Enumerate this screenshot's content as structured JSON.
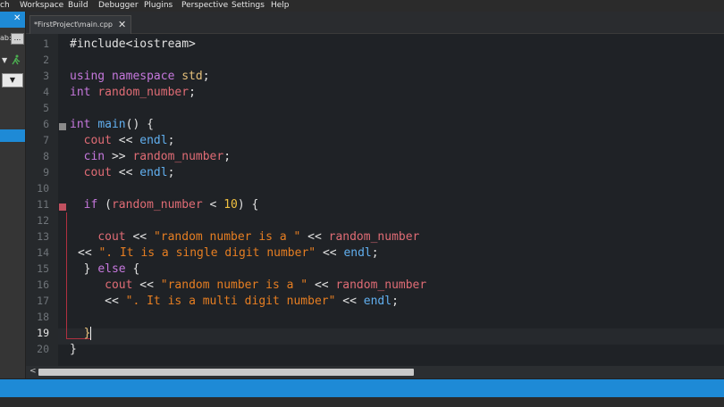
{
  "menu": [
    "ch",
    "Workspace",
    "Build",
    "Debugger",
    "Plugins",
    "Perspective",
    "Settings",
    "Help"
  ],
  "left_panel": {
    "label": "ab:",
    "more": "...",
    "dropdown": "▼"
  },
  "tab": {
    "title": "*FirstProject\\main.cpp",
    "close": "✕"
  },
  "line_numbers": [
    "1",
    "2",
    "3",
    "4",
    "5",
    "6",
    "7",
    "8",
    "9",
    "10",
    "11",
    "12",
    "13",
    "14",
    "15",
    "16",
    "17",
    "18",
    "19",
    "20"
  ],
  "active_line": "19",
  "code": {
    "l1": "#include<iostream>",
    "l3_kw": "using namespace",
    "l3_ns": "std",
    "l3_end": ";",
    "l4_type": "int",
    "l4_var": "random_number",
    "l4_end": ";",
    "l6_type": "int",
    "l6_fn": "main",
    "l6_rest": "() {",
    "l7_id": "cout",
    "l7_op": " << ",
    "l7_end": "endl",
    "l7_semi": ";",
    "l8_id": "cin",
    "l8_op": " >> ",
    "l8_var": "random_number",
    "l8_semi": ";",
    "l9_id": "cout",
    "l9_op": " << ",
    "l9_end": "endl",
    "l9_semi": ";",
    "l11_kw": "if",
    "l11_open": " (",
    "l11_var": "random_number",
    "l11_op": " < ",
    "l11_num": "10",
    "l11_close": ") {",
    "l13_id": "cout",
    "l13_op": " << ",
    "l13_str": "\"random number is a \"",
    "l13_op2": " << ",
    "l13_var": "random_number",
    "l14_op": "<< ",
    "l14_str": "\". It is a single digit number\"",
    "l14_op2": " << ",
    "l14_end": "endl",
    "l14_semi": ";",
    "l15_close": "} ",
    "l15_kw": "else",
    "l15_open": " {",
    "l16_id": "cout",
    "l16_op": " << ",
    "l16_str": "\"random number is a \"",
    "l16_op2": " << ",
    "l16_var": "random_number",
    "l17_op": "<< ",
    "l17_str": "\". It is a multi digit number\"",
    "l17_op2": " << ",
    "l17_end": "endl",
    "l17_semi": ";",
    "l19": "}",
    "l20": "}"
  },
  "scroll_arrow": "<"
}
